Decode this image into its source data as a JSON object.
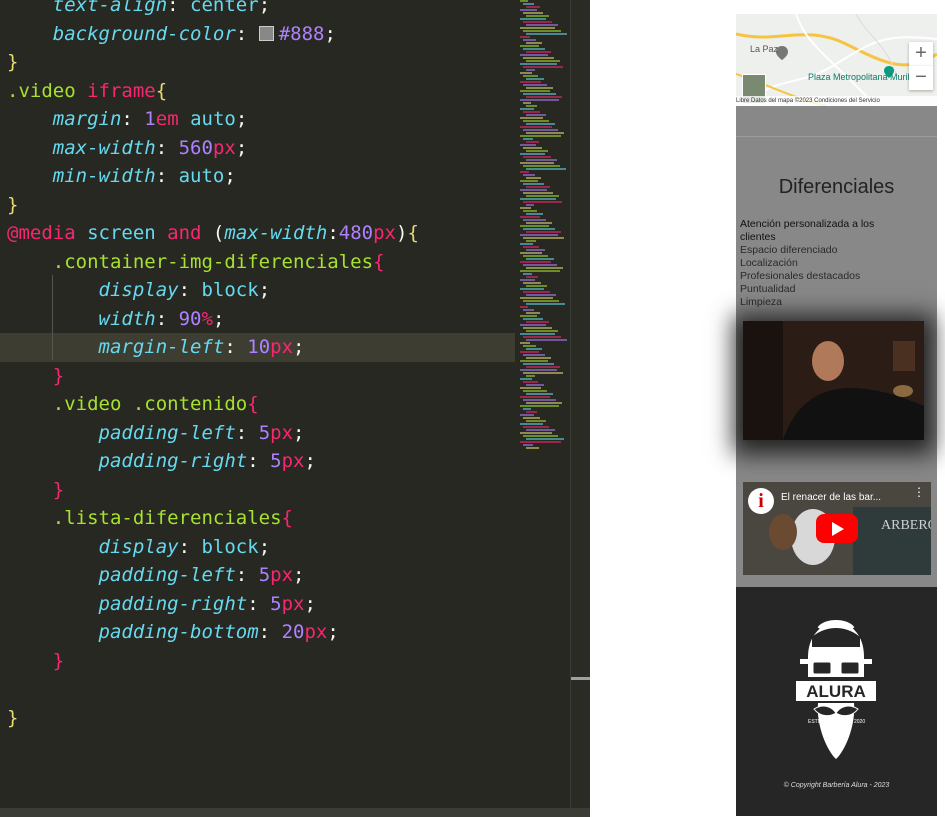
{
  "editor": {
    "lines": [
      [
        {
          "t": "    "
        },
        {
          "t": "text-align",
          "c": "t-prop"
        },
        {
          "t": ": "
        },
        {
          "t": "center",
          "c": "t-val"
        },
        {
          "t": ";"
        }
      ],
      [
        {
          "t": "    "
        },
        {
          "t": "background-color",
          "c": "t-prop"
        },
        {
          "t": ": "
        },
        {
          "t": "",
          "swatch": true
        },
        {
          "t": "#888",
          "c": "t-hex"
        },
        {
          "t": ";"
        }
      ],
      [
        {
          "t": "}",
          "c": "t-brace"
        }
      ],
      [
        {
          "t": ".video ",
          "c": "t-sel"
        },
        {
          "t": "iframe",
          "c": "t-tag"
        },
        {
          "t": "{",
          "c": "t-brace"
        }
      ],
      [
        {
          "t": "    "
        },
        {
          "t": "margin",
          "c": "t-prop"
        },
        {
          "t": ": "
        },
        {
          "t": "1",
          "c": "t-num"
        },
        {
          "t": "em",
          "c": "t-unit"
        },
        {
          "t": " auto",
          "c": "t-val"
        },
        {
          "t": ";"
        }
      ],
      [
        {
          "t": "    "
        },
        {
          "t": "max-width",
          "c": "t-prop"
        },
        {
          "t": ": "
        },
        {
          "t": "560",
          "c": "t-num"
        },
        {
          "t": "px",
          "c": "t-unit"
        },
        {
          "t": ";"
        }
      ],
      [
        {
          "t": "    "
        },
        {
          "t": "min-width",
          "c": "t-prop"
        },
        {
          "t": ": "
        },
        {
          "t": "auto",
          "c": "t-val"
        },
        {
          "t": ";"
        }
      ],
      [
        {
          "t": "}",
          "c": "t-brace"
        }
      ],
      [
        {
          "t": "@media",
          "c": "t-at"
        },
        {
          "t": " screen ",
          "c": "t-val"
        },
        {
          "t": "and",
          "c": "t-kw"
        },
        {
          "t": " ("
        },
        {
          "t": "max-width",
          "c": "t-prop"
        },
        {
          "t": ":"
        },
        {
          "t": "480",
          "c": "t-num"
        },
        {
          "t": "px",
          "c": "t-unit"
        },
        {
          "t": ")"
        },
        {
          "t": "{",
          "c": "t-brace"
        }
      ],
      [
        {
          "t": "    "
        },
        {
          "t": ".container-img-diferenciales",
          "c": "t-sel"
        },
        {
          "t": "{",
          "c": "t-brace2"
        }
      ],
      [
        {
          "t": "        "
        },
        {
          "t": "display",
          "c": "t-prop"
        },
        {
          "t": ": "
        },
        {
          "t": "block",
          "c": "t-val"
        },
        {
          "t": ";"
        }
      ],
      [
        {
          "t": "        "
        },
        {
          "t": "width",
          "c": "t-prop"
        },
        {
          "t": ": "
        },
        {
          "t": "90",
          "c": "t-num"
        },
        {
          "t": "%",
          "c": "t-unit"
        },
        {
          "t": ";"
        }
      ],
      [
        {
          "t": "        "
        },
        {
          "t": "margin-left",
          "c": "t-prop"
        },
        {
          "t": ": "
        },
        {
          "t": "10",
          "c": "t-num"
        },
        {
          "t": "px",
          "c": "t-unit"
        },
        {
          "t": ";"
        }
      ],
      [
        {
          "t": "    "
        },
        {
          "t": "}",
          "c": "t-brace2"
        }
      ],
      [
        {
          "t": "    "
        },
        {
          "t": ".video .contenido",
          "c": "t-sel"
        },
        {
          "t": "{",
          "c": "t-brace2"
        }
      ],
      [
        {
          "t": "        "
        },
        {
          "t": "padding-left",
          "c": "t-prop"
        },
        {
          "t": ": "
        },
        {
          "t": "5",
          "c": "t-num"
        },
        {
          "t": "px",
          "c": "t-unit"
        },
        {
          "t": ";"
        }
      ],
      [
        {
          "t": "        "
        },
        {
          "t": "padding-right",
          "c": "t-prop"
        },
        {
          "t": ": "
        },
        {
          "t": "5",
          "c": "t-num"
        },
        {
          "t": "px",
          "c": "t-unit"
        },
        {
          "t": ";"
        }
      ],
      [
        {
          "t": "    "
        },
        {
          "t": "}",
          "c": "t-brace2"
        }
      ],
      [
        {
          "t": "    "
        },
        {
          "t": ".lista-diferenciales",
          "c": "t-sel"
        },
        {
          "t": "{",
          "c": "t-brace2"
        }
      ],
      [
        {
          "t": "        "
        },
        {
          "t": "display",
          "c": "t-prop"
        },
        {
          "t": ": "
        },
        {
          "t": "block",
          "c": "t-val"
        },
        {
          "t": ";"
        }
      ],
      [
        {
          "t": "        "
        },
        {
          "t": "padding-left",
          "c": "t-prop"
        },
        {
          "t": ": "
        },
        {
          "t": "5",
          "c": "t-num"
        },
        {
          "t": "px",
          "c": "t-unit"
        },
        {
          "t": ";"
        }
      ],
      [
        {
          "t": "        "
        },
        {
          "t": "padding-right",
          "c": "t-prop"
        },
        {
          "t": ": "
        },
        {
          "t": "5",
          "c": "t-num"
        },
        {
          "t": "px",
          "c": "t-unit"
        },
        {
          "t": ";"
        }
      ],
      [
        {
          "t": "        "
        },
        {
          "t": "padding-bottom",
          "c": "t-prop"
        },
        {
          "t": ": "
        },
        {
          "t": "20",
          "c": "t-num"
        },
        {
          "t": "px",
          "c": "t-unit"
        },
        {
          "t": ";"
        }
      ],
      [
        {
          "t": "    "
        },
        {
          "t": "}",
          "c": "t-brace2"
        }
      ],
      [
        {
          "t": ""
        }
      ],
      [
        {
          "t": "}",
          "c": "t-brace"
        }
      ]
    ],
    "highlighted_line": 12,
    "colors": {
      "background": "#272822",
      "current_line": "#3e3d32"
    }
  },
  "preview": {
    "map": {
      "zoom_in": "+",
      "zoom_out": "−",
      "place_lapaz": "La Paz",
      "place_plaza": "Plaza Metropolitana Murillo",
      "footer": "Libre   Datos del mapa ©2023   Condiciones del Servicio"
    },
    "diferenciales": {
      "title": "Diferenciales",
      "items": [
        "Atención personalizada a los clientes",
        "Espacio diferenciado",
        "Localización",
        "Profesionales destacados",
        "Puntualidad",
        "Limpieza"
      ]
    },
    "video": {
      "title": "El renacer de las bar...",
      "channel_icon": "i",
      "menu": "⋮"
    },
    "footer": {
      "logo_text": "ALURA",
      "logo_est": "ESTD",
      "logo_year": "2020",
      "copyright": "© Copyright Barbería Alura - 2023"
    }
  }
}
